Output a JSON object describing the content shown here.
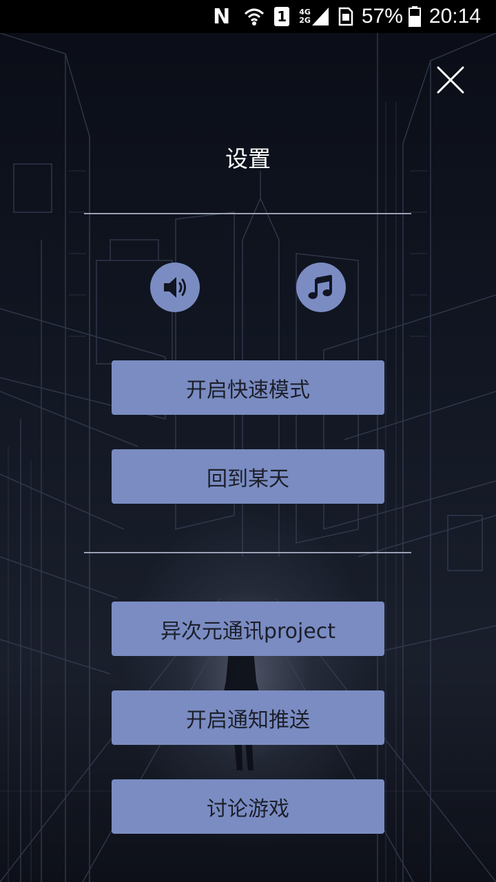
{
  "status_bar": {
    "n_badge": "N",
    "sim_slot": "1",
    "network_4g": "4G",
    "network_2g": "2G",
    "battery_percent": "57%",
    "time": "20:14"
  },
  "header": {
    "title": "设置"
  },
  "audio_controls": [
    {
      "name": "sound-toggle",
      "icon": "speaker-icon"
    },
    {
      "name": "music-toggle",
      "icon": "music-note-icon"
    }
  ],
  "menu": {
    "fast_mode": "开启快速模式",
    "back_to_day": "回到某天",
    "project": "异次元通讯project",
    "notifications": "开启通知推送",
    "discuss": "讨论游戏"
  },
  "colors": {
    "accent_button": "#7a8cc2",
    "button_text": "#1c1f2a",
    "divider": "#9aa2b6",
    "status_bar": "#000000"
  }
}
